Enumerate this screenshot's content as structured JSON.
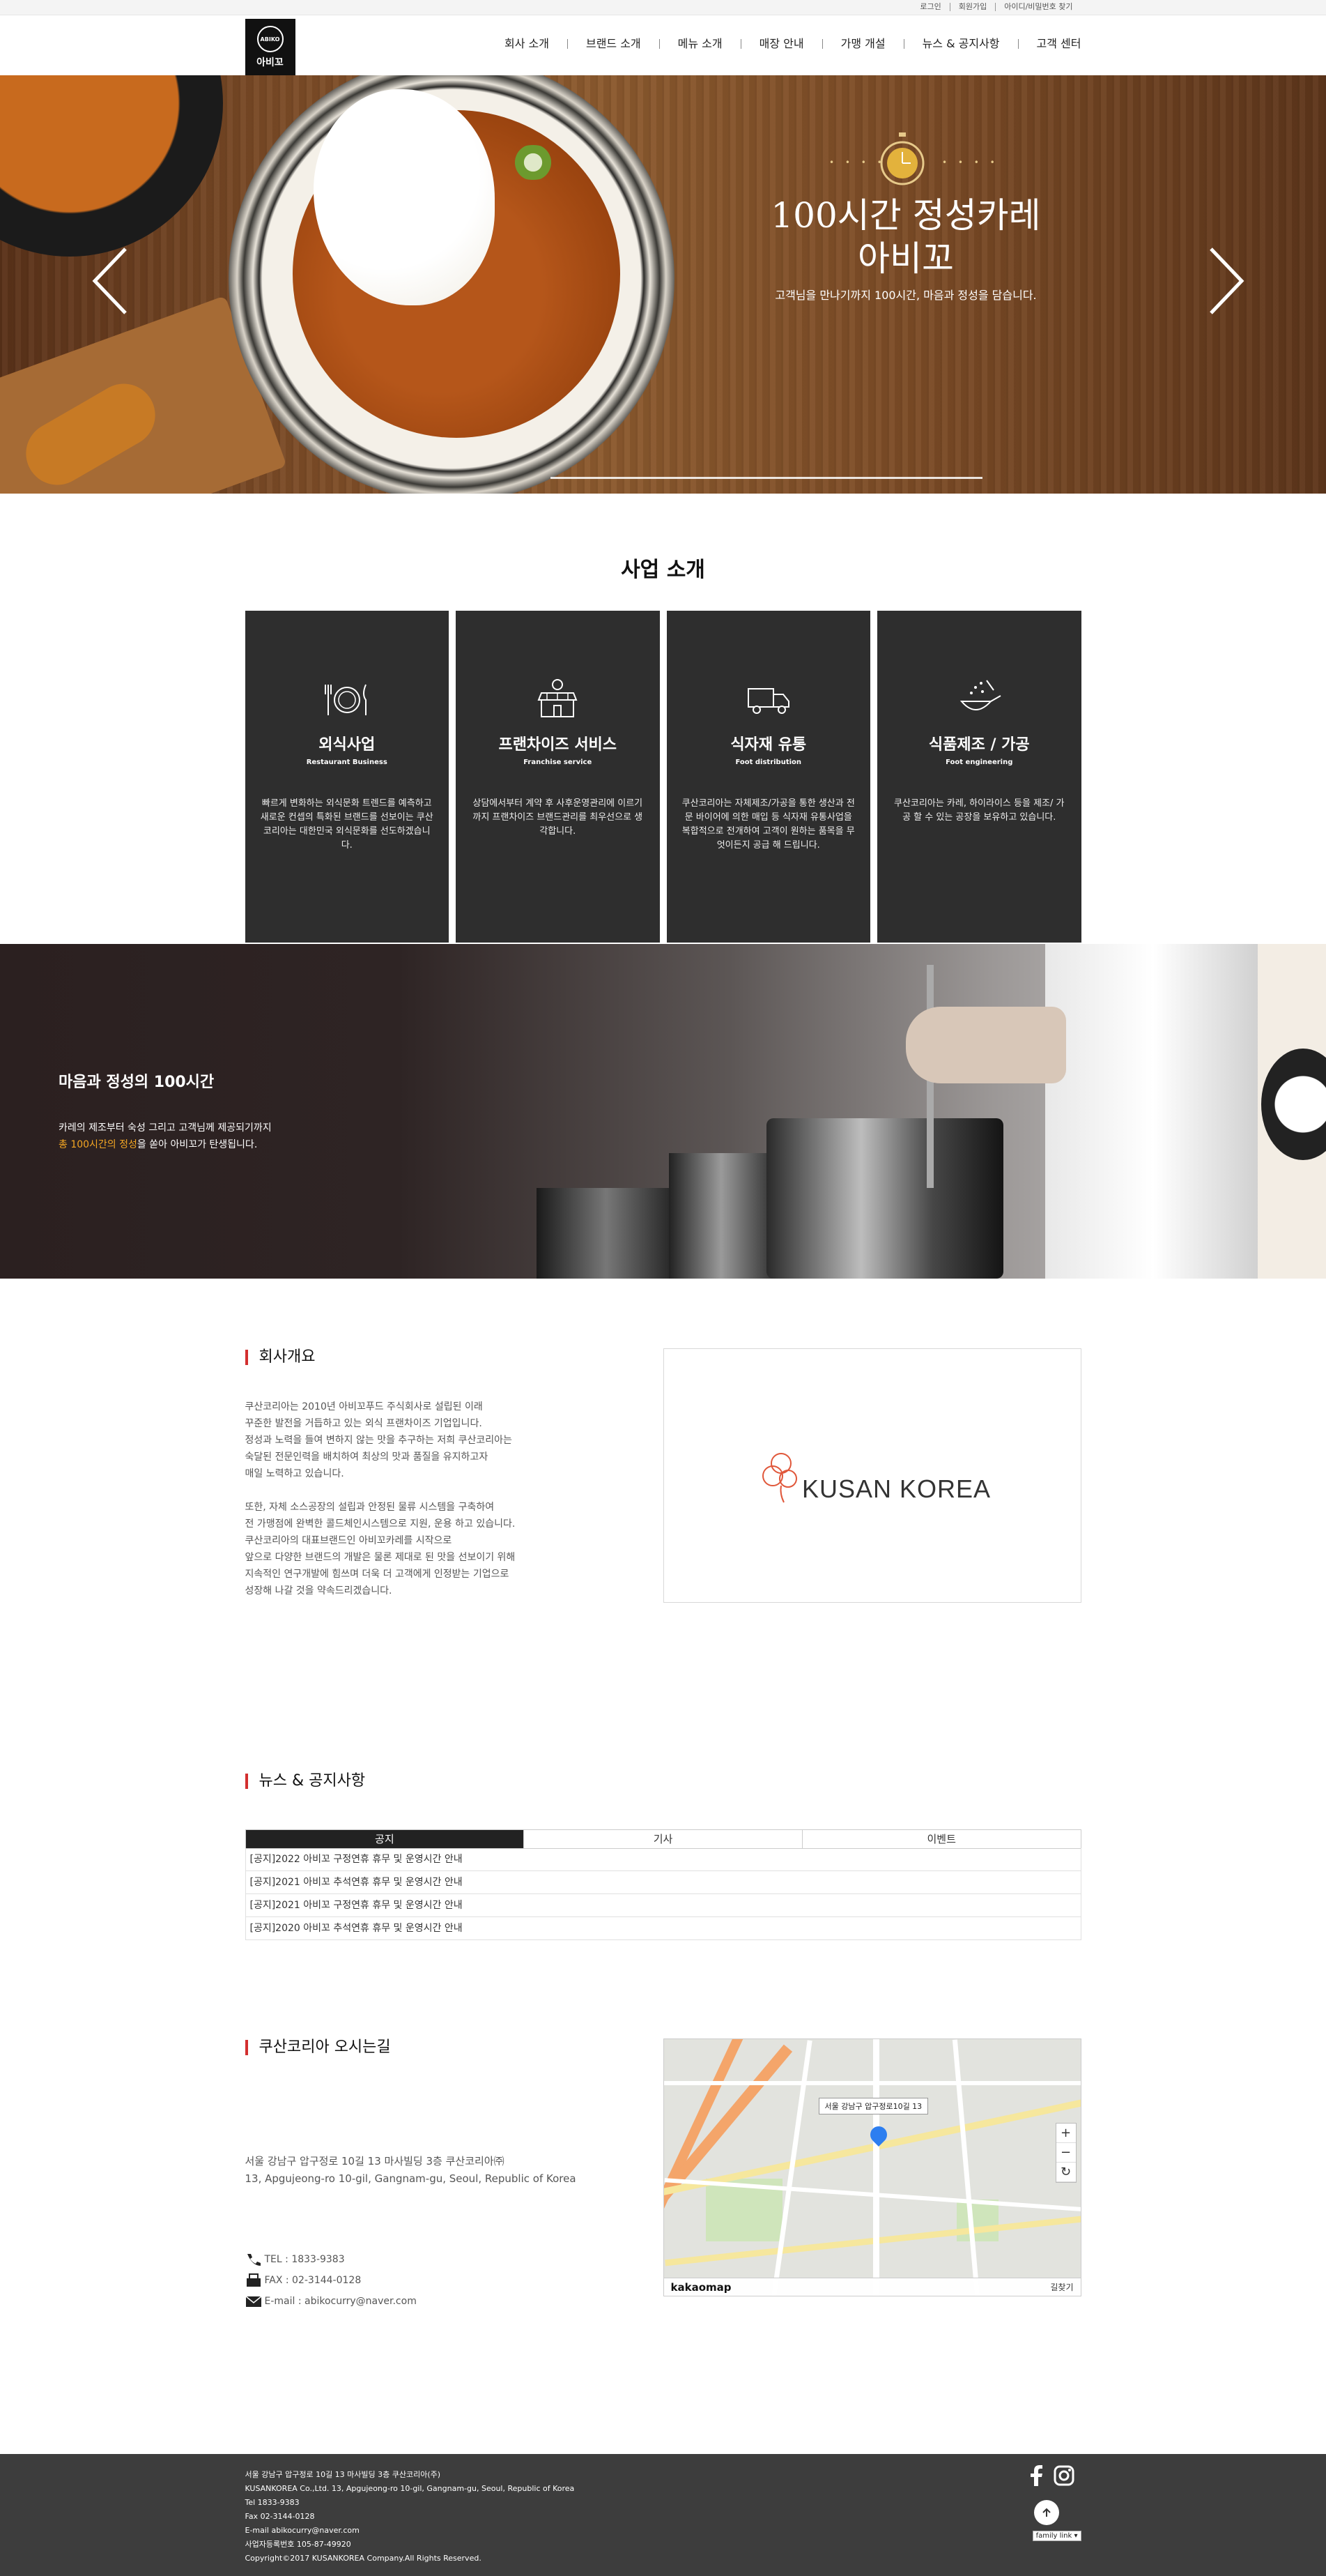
{
  "topbar": {
    "links": [
      "로그인",
      "회원가입",
      "아이디/비밀번호 찾기"
    ]
  },
  "header": {
    "logo_badge": "ABIKO",
    "logo_name": "아비꼬",
    "nav": [
      "회사 소개",
      "브랜드 소개",
      "메뉴 소개",
      "매장 안내",
      "가맹 개설",
      "뉴스 & 공지사항",
      "고객 센터"
    ]
  },
  "hero": {
    "title_line1": "100시간 정성카레",
    "title_line2": "아비꼬",
    "subtitle": "고객님을 만나기까지 100시간, 마음과 정성을 담습니다."
  },
  "business": {
    "title": "사업 소개",
    "cards": [
      {
        "icon": "dining-icon",
        "title": "외식사업",
        "en": "Restaurant Business",
        "desc": "빠르게 변화하는 외식문화 트렌드를 예측하고 새로운 컨셉의 특화된 브랜드를 선보이는 쿠산코리아는 대한민국 외식문화를 선도하겠습니다."
      },
      {
        "icon": "store-icon",
        "title": "프랜차이즈 서비스",
        "en": "Franchise service",
        "desc": "상담에서부터 계약 후 사후운영관리에 이르기까지 프랜차이즈 브랜드관리를 최우선으로 생각합니다."
      },
      {
        "icon": "truck-icon",
        "title": "식자재 유통",
        "en": "Foot distribution",
        "desc": "쿠산코리아는 자체제조/가공을 통한 생산과 전문 바이어에 의한 매입 등 식자재 유통사업을 복합적으로 전개하여 고객이 원하는 품목을 무엇이든지 공급 해 드립니다."
      },
      {
        "icon": "cooking-pan-icon",
        "title": "식품제조 / 가공",
        "en": "Foot engineering",
        "desc": "쿠산코리아는 카레, 하이라이스 등을 제조/ 가공 할 수 있는 공장을 보유하고 있습니다."
      }
    ]
  },
  "chef": {
    "title": "마음과 정성의 100시간",
    "line1": "카레의 제조부터 숙성 그리고 고객님께 제공되기까지",
    "highlight": "총 100시간의 정성",
    "line2_rest": "을 쏟아 아비꼬가 탄생됩니다."
  },
  "about": {
    "title": "회사개요",
    "para1": [
      "쿠산코리아는 2010년 아비꼬푸드 주식회사로 설립된 이래",
      "꾸준한 발전을 거듭하고 있는 외식 프랜차이즈 기업입니다.",
      "정성과 노력을 들여 변하지 않는 맛을 추구하는 저희 쿠산코리아는",
      "숙달된 전문인력을 배치하여 최상의 맛과 품질을 유지하고자",
      "매일 노력하고 있습니다."
    ],
    "para2": [
      "또한, 자체 소스공장의 설립과 안정된 물류 시스템을 구축하여",
      "전 가맹점에 완벽한 콜드체인시스템으로 지원, 운용 하고 있습니다.",
      "쿠산코리아의 대표브랜드인 아비꼬카레를 시작으로",
      "앞으로 다양한 브랜드의 개발은 물론 제대로 된 맛을 선보이기 위해",
      "지속적인 연구개발에 힘쓰며 더욱 더 고객에게 인정받는 기업으로",
      "성장해 나갈 것을 약속드리겠습니다."
    ],
    "logo_text": "KUSAN KOREA"
  },
  "news": {
    "title": "뉴스 & 공지사항",
    "tabs": [
      "공지",
      "기사",
      "이벤트"
    ],
    "items": [
      "[공지]2022 아비꼬 구정연휴 휴무 및 운영시간 안내",
      "[공지]2021 아비꼬 추석연휴 휴무 및 운영시간 안내",
      "[공지]2021 아비꼬 구정연휴 휴무 및 운영시간 안내",
      "[공지]2020 아비꼬 추석연휴 휴무 및 운영시간 안내"
    ]
  },
  "location": {
    "title": "쿠산코리아 오시는길",
    "addr_ko": "서울 강남구 압구정로 10길 13 마사빌딩 3층 쿠산코리아㈜",
    "addr_en": "13, Apgujeong-ro 10-gil, Gangnam-gu, Seoul, Republic of Korea",
    "tel": "TEL : 1833-9383",
    "fax": "FAX : 02-3144-0128",
    "email": "E-mail : abikocurry@naver.com",
    "map_label": "서울 강남구 압구정로10길 13",
    "map_brand": "kakaomap",
    "map_link": "길찾기"
  },
  "footer": {
    "lines": [
      "서울 강남구 압구정로 10길 13 마사빌딩 3층 쿠산코리아(주)",
      "KUSANKOREA Co.,Ltd. 13, Apgujeong-ro 10-gil, Gangnam-gu, Seoul, Republic of Korea",
      "Tel 1833-9383",
      "Fax 02-3144-0128",
      "E-mail abikocurry@naver.com",
      "사업자등록번호 105-87-49920",
      "Copyright©2017 KUSANKOREA Company.All Rights Reserved."
    ],
    "family_link": "family link"
  }
}
